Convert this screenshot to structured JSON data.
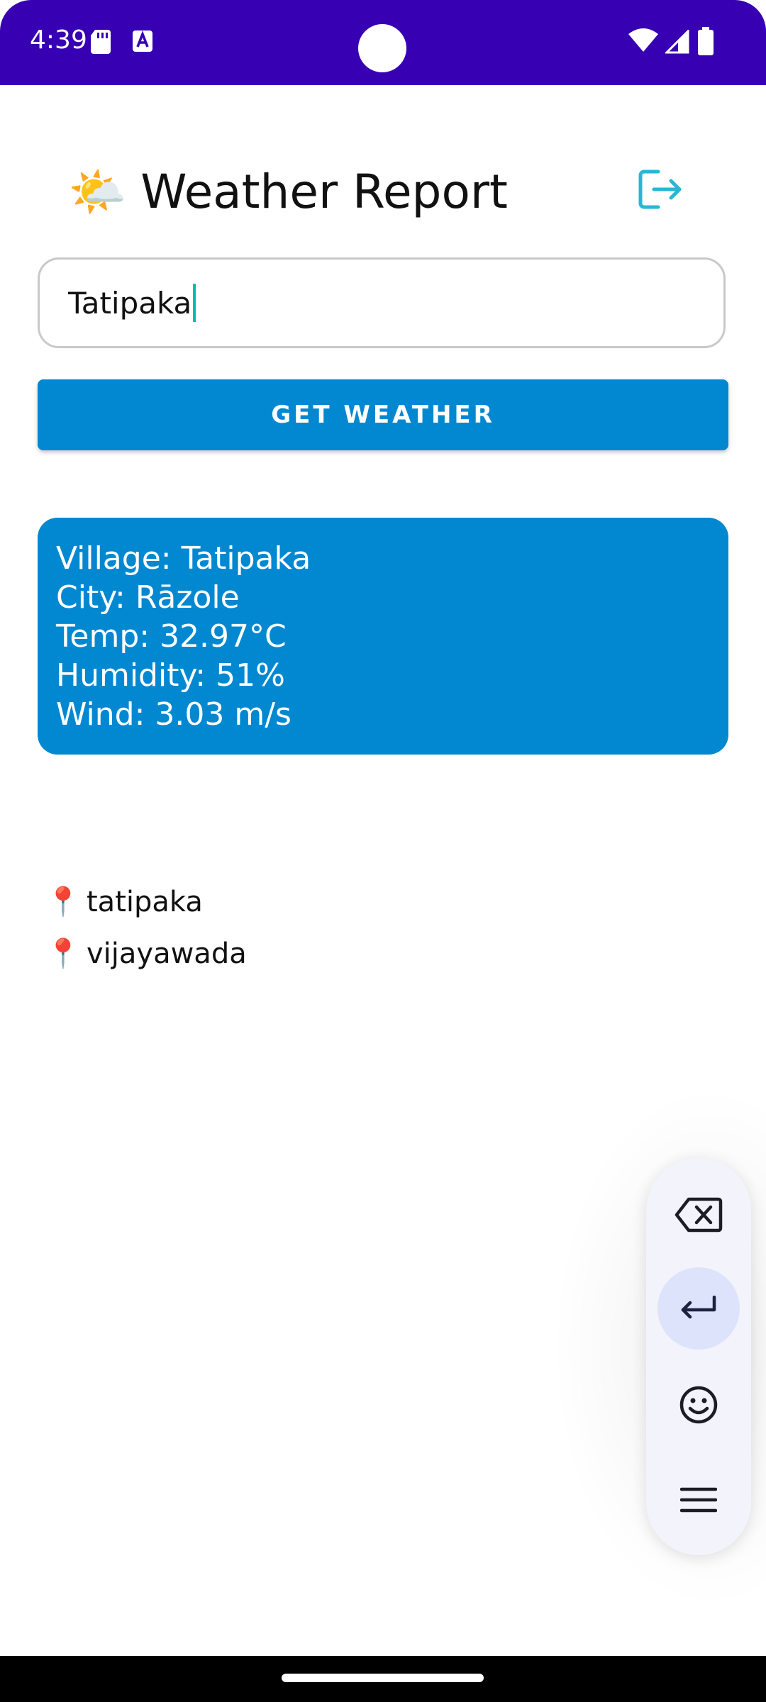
{
  "status_bar": {
    "time": "4:39",
    "background_color": "#3700b3",
    "icons": [
      "sd-card-icon",
      "keyboard-a-icon",
      "camera-cutout",
      "wifi-icon",
      "signal-icon",
      "battery-icon"
    ]
  },
  "header": {
    "emoji": "🌤️",
    "title": "Weather Report",
    "logout_icon": "logout-icon",
    "logout_color": "#29b6d6"
  },
  "search": {
    "value": "Tatipaka",
    "placeholder": "",
    "caret_color": "#00bfa5"
  },
  "get_weather_button": {
    "label": "GET WEATHER",
    "color": "#0288d1"
  },
  "weather_card": {
    "color": "#0288d1",
    "village": "Village: Tatipaka",
    "city": "City: Rāzole",
    "temp": "Temp: 32.97°C",
    "humidity": "Humidity: 51%",
    "wind": "Wind: 3.03 m/s"
  },
  "recent_searches": [
    {
      "icon": "📍",
      "label": "tatipaka"
    },
    {
      "icon": "📍",
      "label": "vijayawada"
    }
  ],
  "keyboard_toolbar": {
    "buttons": [
      "backspace-icon",
      "enter-icon",
      "emoji-icon",
      "menu-icon"
    ],
    "highlight_color": "#dde3fb"
  },
  "nav_bar": {
    "background_color": "#000000"
  }
}
